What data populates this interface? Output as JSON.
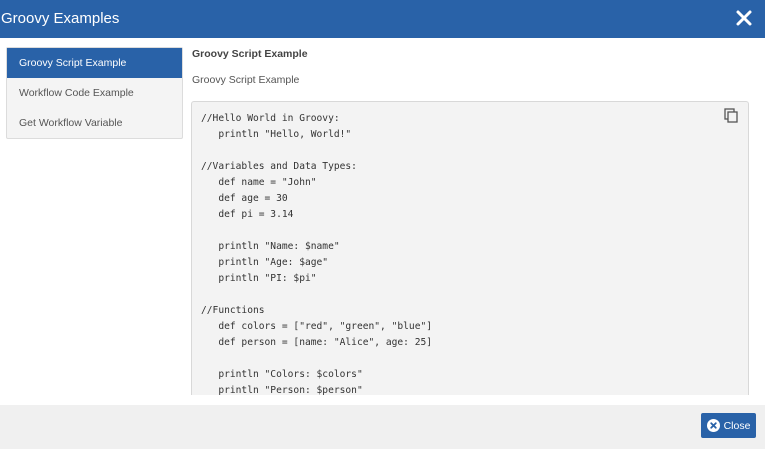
{
  "dialog": {
    "title": "Groovy Examples"
  },
  "sidebar": {
    "items": [
      {
        "label": "Groovy Script Example",
        "active": true
      },
      {
        "label": "Workflow Code Example",
        "active": false
      },
      {
        "label": "Get Workflow Variable",
        "active": false
      }
    ]
  },
  "main": {
    "heading": "Groovy Script Example",
    "description": "Groovy Script Example",
    "code": "//Hello World in Groovy:\n   println \"Hello, World!\"\n\n//Variables and Data Types:\n   def name = \"John\"\n   def age = 30\n   def pi = 3.14\n\n   println \"Name: $name\"\n   println \"Age: $age\"\n   println \"PI: $pi\"\n\n//Functions\n   def colors = [\"red\", \"green\", \"blue\"]\n   def person = [name: \"Alice\", age: 25]\n\n   println \"Colors: $colors\"\n   println \"Person: $person\"",
    "copy_icon": "copy-icon"
  },
  "footer": {
    "close_label": "Close",
    "close_icon": "close-circle-icon"
  },
  "colors": {
    "accent": "#2962a8",
    "code_background": "#f3f3f3",
    "footer_background": "#f0f0f0"
  }
}
